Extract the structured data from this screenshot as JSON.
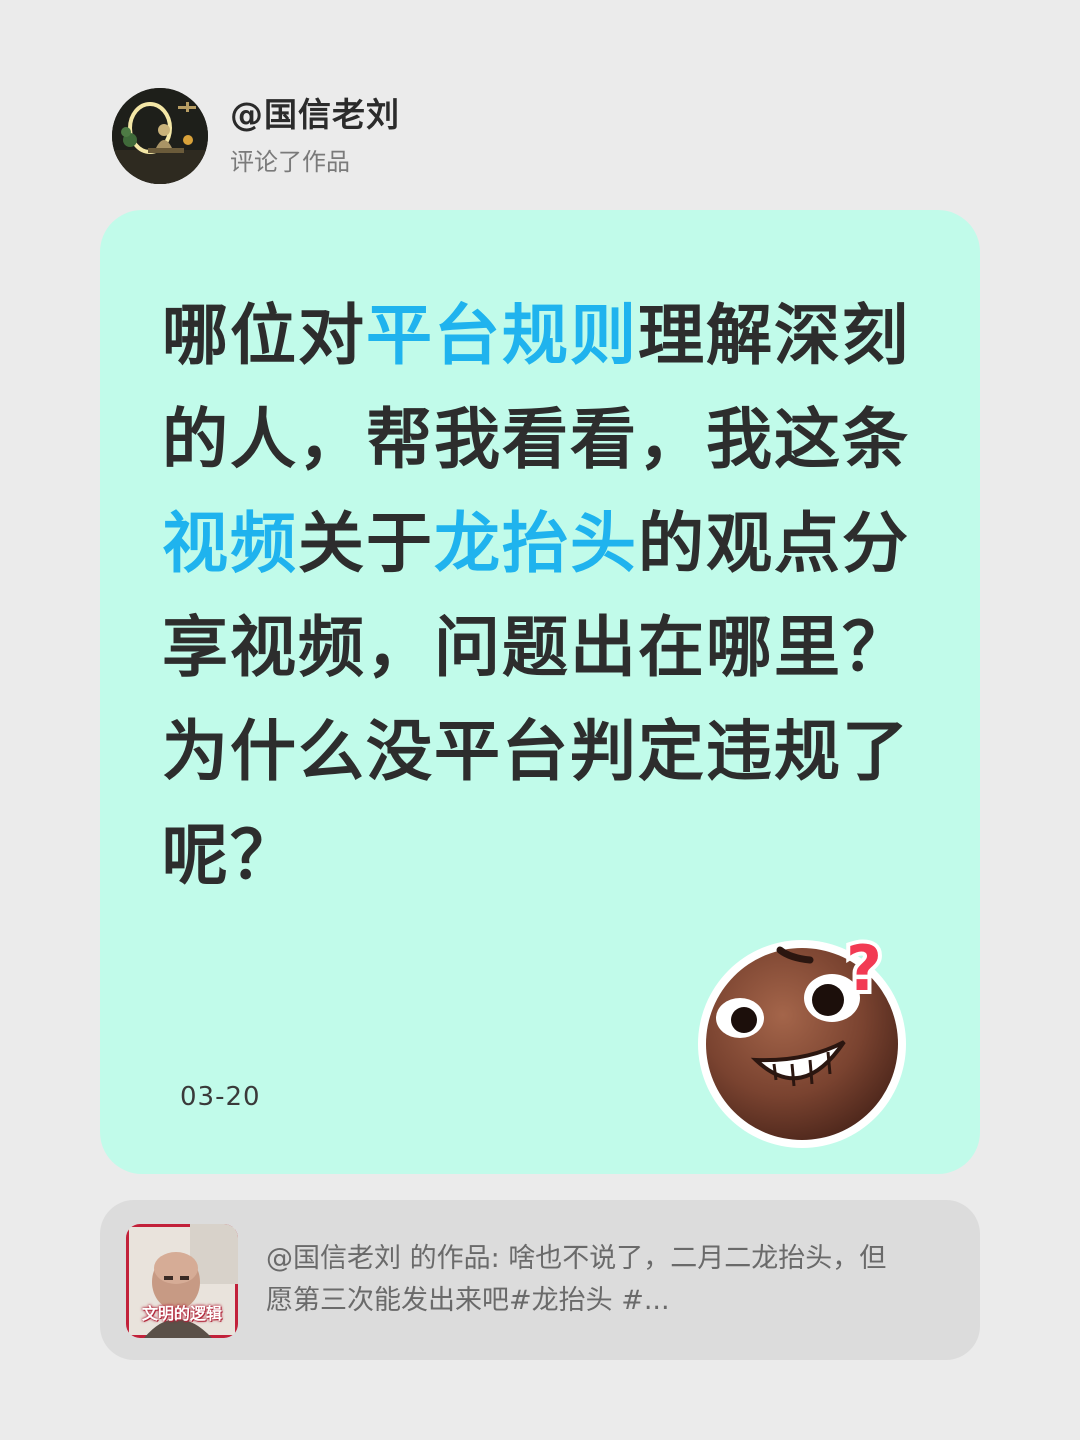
{
  "header": {
    "username": "@国信老刘",
    "subtitle": "评论了作品",
    "avatar_icon": "avatar-seated-figure-moon"
  },
  "comment": {
    "segments": [
      {
        "text": "哪位对",
        "highlight": false
      },
      {
        "text": "平台规则",
        "highlight": true
      },
      {
        "text": "理解深刻的人，帮我看看，我这条",
        "highlight": false
      },
      {
        "text": "视频",
        "highlight": true
      },
      {
        "text": "关于",
        "highlight": false
      },
      {
        "text": "龙抬头",
        "highlight": true
      },
      {
        "text": "的观点分享视频，问题出在哪里？为什么没平台判定违规了呢？",
        "highlight": false
      }
    ],
    "date": "03-20",
    "emoji_icon": "confused-smiling-face-with-question-mark-icon"
  },
  "reference": {
    "thumbnail_caption": "文明的逻辑",
    "text": "@国信老刘 的作品: 啥也不说了，二月二龙抬头，但愿第三次能发出来吧#龙抬头 #..."
  },
  "colors": {
    "page_background": "#ebebeb",
    "card_background": "#c1fbea",
    "highlight": "#1fb3ee",
    "reference_background": "#dcdcdc"
  }
}
